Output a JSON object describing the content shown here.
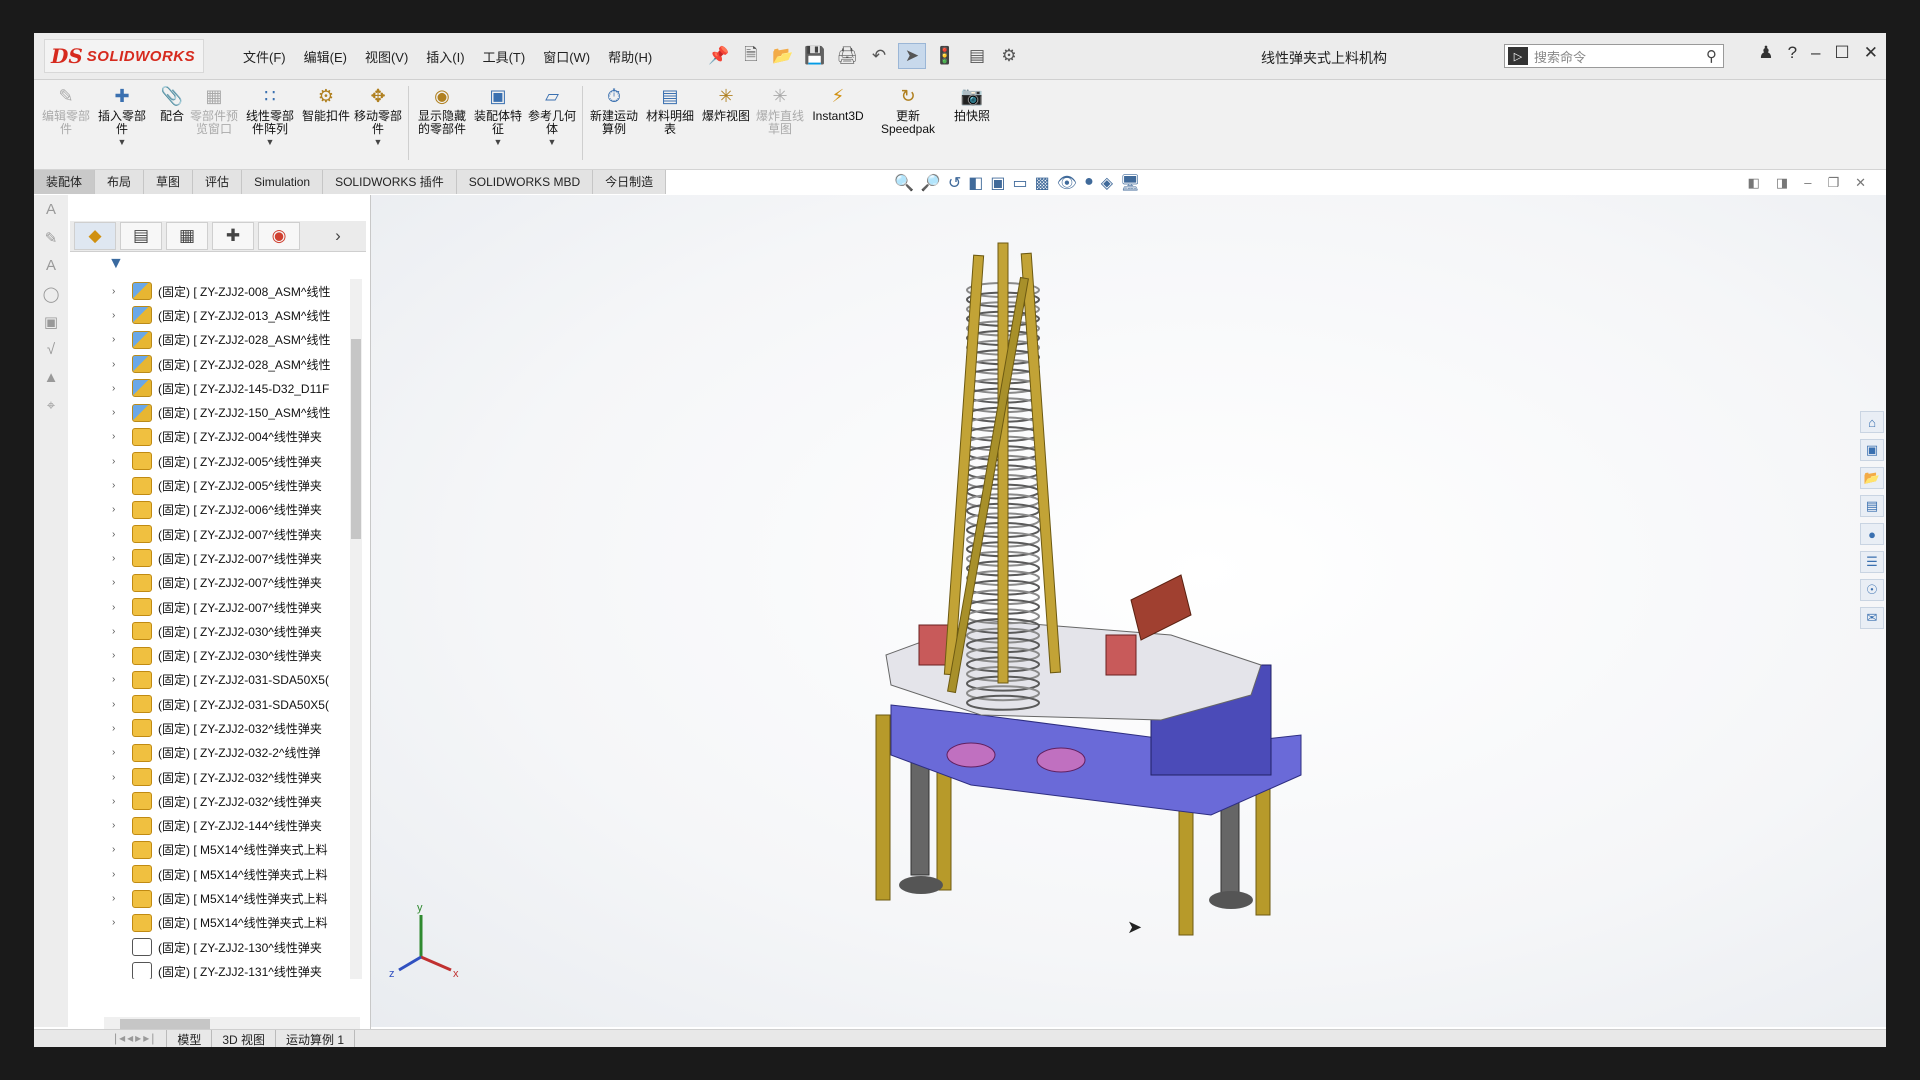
{
  "app": {
    "logo_prefix": "DS",
    "logo_text": "SOLIDWORKS",
    "document_title": "线性弹夹式上料机构",
    "brand_color": "#d62a1e"
  },
  "menu": [
    "文件(F)",
    "编辑(E)",
    "视图(V)",
    "插入(I)",
    "工具(T)",
    "窗口(W)",
    "帮助(H)"
  ],
  "quick_access_icons": [
    "new-icon",
    "open-icon",
    "save-icon",
    "print-icon",
    "undo-icon",
    "select-icon",
    "rebuild-icon",
    "file-properties-icon",
    "options-icon"
  ],
  "search": {
    "placeholder": "搜索命令"
  },
  "commands": [
    {
      "label": "编辑零部件",
      "enabled": false
    },
    {
      "label": "插入零部件",
      "enabled": true
    },
    {
      "label": "配合",
      "enabled": true
    },
    {
      "label": "零部件预览窗口",
      "enabled": false
    },
    {
      "label": "线性零部件阵列",
      "enabled": true
    },
    {
      "label": "智能扣件",
      "enabled": true
    },
    {
      "label": "移动零部件",
      "enabled": true
    },
    {
      "label": "显示隐藏的零部件",
      "enabled": true
    },
    {
      "label": "装配体特征",
      "enabled": true
    },
    {
      "label": "参考几何体",
      "enabled": true
    },
    {
      "label": "新建运动算例",
      "enabled": true
    },
    {
      "label": "材料明细表",
      "enabled": true
    },
    {
      "label": "爆炸视图",
      "enabled": true
    },
    {
      "label": "爆炸直线草图",
      "enabled": false
    },
    {
      "label": "Instant3D",
      "enabled": true
    },
    {
      "label": "更新Speedpak",
      "enabled": true
    },
    {
      "label": "拍快照",
      "enabled": true
    }
  ],
  "tabs": [
    "装配体",
    "布局",
    "草图",
    "评估",
    "Simulation",
    "SOLIDWORKS 插件",
    "SOLIDWORKS MBD",
    "今日制造"
  ],
  "active_tab": "装配体",
  "tree_items": [
    {
      "text": "(固定) [ ZY-ZJJ2-008_ASM^线性",
      "type": "asm"
    },
    {
      "text": "(固定) [ ZY-ZJJ2-013_ASM^线性",
      "type": "asm"
    },
    {
      "text": "(固定) [ ZY-ZJJ2-028_ASM^线性",
      "type": "asm"
    },
    {
      "text": "(固定) [ ZY-ZJJ2-028_ASM^线性",
      "type": "asm"
    },
    {
      "text": "(固定) [ ZY-ZJJ2-145-D32_D11F",
      "type": "asm"
    },
    {
      "text": "(固定) [ ZY-ZJJ2-150_ASM^线性",
      "type": "asm"
    },
    {
      "text": "(固定) [ ZY-ZJJ2-004^线性弹夹",
      "type": "part"
    },
    {
      "text": "(固定) [ ZY-ZJJ2-005^线性弹夹",
      "type": "part"
    },
    {
      "text": "(固定) [ ZY-ZJJ2-005^线性弹夹",
      "type": "part"
    },
    {
      "text": "(固定) [ ZY-ZJJ2-006^线性弹夹",
      "type": "part"
    },
    {
      "text": "(固定) [ ZY-ZJJ2-007^线性弹夹",
      "type": "part"
    },
    {
      "text": "(固定) [ ZY-ZJJ2-007^线性弹夹",
      "type": "part"
    },
    {
      "text": "(固定) [ ZY-ZJJ2-007^线性弹夹",
      "type": "part"
    },
    {
      "text": "(固定) [ ZY-ZJJ2-007^线性弹夹",
      "type": "part"
    },
    {
      "text": "(固定) [ ZY-ZJJ2-030^线性弹夹",
      "type": "part"
    },
    {
      "text": "(固定) [ ZY-ZJJ2-030^线性弹夹",
      "type": "part"
    },
    {
      "text": "(固定) [ ZY-ZJJ2-031-SDA50X5(",
      "type": "part"
    },
    {
      "text": "(固定) [ ZY-ZJJ2-031-SDA50X5(",
      "type": "part"
    },
    {
      "text": "(固定) [ ZY-ZJJ2-032^线性弹夹",
      "type": "part"
    },
    {
      "text": "(固定) [ ZY-ZJJ2-032-2^线性弹",
      "type": "part"
    },
    {
      "text": "(固定) [ ZY-ZJJ2-032^线性弹夹",
      "type": "part"
    },
    {
      "text": "(固定) [ ZY-ZJJ2-032^线性弹夹",
      "type": "part"
    },
    {
      "text": "(固定) [ ZY-ZJJ2-144^线性弹夹",
      "type": "part"
    },
    {
      "text": "(固定) [ M5X14^线性弹夹式上料",
      "type": "part"
    },
    {
      "text": "(固定) [ M5X14^线性弹夹式上料",
      "type": "part"
    },
    {
      "text": "(固定) [ M5X14^线性弹夹式上料",
      "type": "part"
    },
    {
      "text": "(固定) [ M5X14^线性弹夹式上料",
      "type": "part"
    },
    {
      "text": "(固定) [ ZY-ZJJ2-130^线性弹夹",
      "type": "out"
    },
    {
      "text": "(固定) [ ZY-ZJJ2-131^线性弹夹",
      "type": "out"
    }
  ],
  "bottom_tabs": [
    "模型",
    "3D 视图",
    "运动算例 1"
  ],
  "triad": {
    "x": "x",
    "y": "y",
    "z": "z"
  }
}
